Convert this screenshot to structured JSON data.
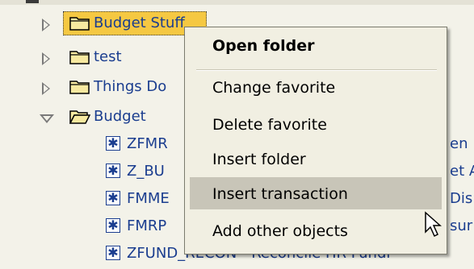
{
  "tree": {
    "folders": [
      {
        "label": "Budget Stuff",
        "state": "collapsed",
        "selected": true
      },
      {
        "label": "test",
        "state": "collapsed"
      },
      {
        "label": "Things Do",
        "state": "collapsed"
      },
      {
        "label": "Budget",
        "state": "expanded"
      }
    ],
    "transactions": [
      {
        "code": "ZFMR",
        "tail": "en"
      },
      {
        "code": "Z_BU",
        "tail": "et A"
      },
      {
        "code": "FMME",
        "tail": "Dis"
      },
      {
        "code": "FMRP",
        "tail": "sur"
      },
      {
        "label": "ZFUND_RECON - Reconcile HR Fundi"
      }
    ]
  },
  "context_menu": {
    "items": [
      {
        "label": "Open folder"
      },
      {
        "label": "Change favorite"
      },
      {
        "label": "Delete favorite"
      },
      {
        "label": "Insert folder"
      },
      {
        "label": "Insert transaction",
        "highlighted": true
      },
      {
        "label": "Add other objects"
      }
    ]
  },
  "colors": {
    "background": "#F3F2E9",
    "tree_text": "#1A3D8F",
    "selected_background": "#F5C842",
    "menu_background": "#F1EFE2",
    "menu_hover": "#C8C5B8"
  }
}
